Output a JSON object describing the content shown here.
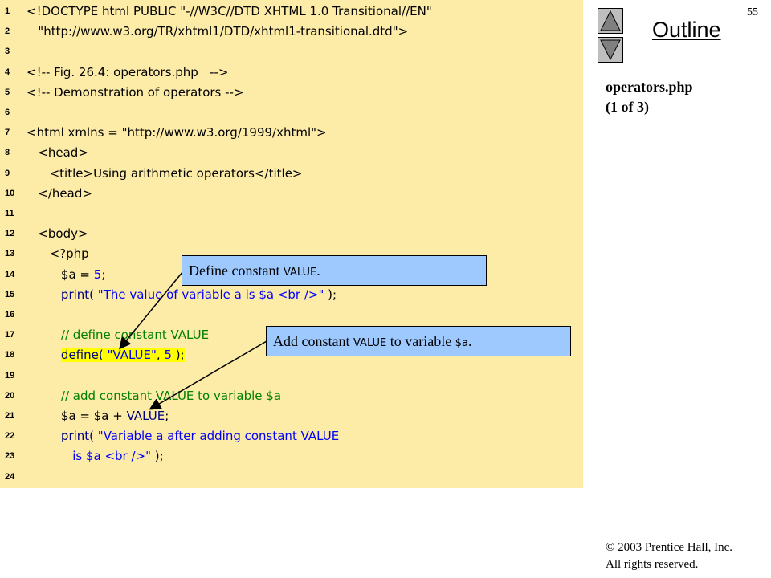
{
  "slide_number": "55",
  "outline_label": "Outline",
  "file_label_line1": "operators.php",
  "file_label_line2": "(1 of 3)",
  "copyright_line1": "© 2003 Prentice Hall, Inc.",
  "copyright_line2": "All rights reserved.",
  "callout1": {
    "prefix": "Define constant ",
    "code": "VALUE",
    "suffix": "."
  },
  "callout2": {
    "prefix": "Add constant ",
    "code": "VALUE",
    "mid": " to variable ",
    "code2": "$a",
    "suffix": "."
  },
  "code_lines": [
    {
      "n": "1",
      "segments": [
        {
          "t": "<!DOCTYPE html PUBLIC \"-//W3C//DTD XHTML 1.0 Transitional//EN\"",
          "c": "plain"
        }
      ]
    },
    {
      "n": "2",
      "segments": [
        {
          "t": "   \"http://www.w3.org/TR/xhtml1/DTD/xhtml1-transitional.dtd\">",
          "c": "plain"
        }
      ]
    },
    {
      "n": "3",
      "segments": []
    },
    {
      "n": "4",
      "segments": [
        {
          "t": "<!-- Fig. 26.4: operators.php   -->",
          "c": "plain"
        }
      ]
    },
    {
      "n": "5",
      "segments": [
        {
          "t": "<!-- Demonstration of operators -->",
          "c": "plain"
        }
      ]
    },
    {
      "n": "6",
      "segments": []
    },
    {
      "n": "7",
      "segments": [
        {
          "t": "<html xmlns = \"http://www.w3.org/1999/xhtml\">",
          "c": "plain"
        }
      ]
    },
    {
      "n": "8",
      "segments": [
        {
          "t": "   <head>",
          "c": "plain"
        }
      ]
    },
    {
      "n": "9",
      "segments": [
        {
          "t": "      <title>Using arithmetic operators</title>",
          "c": "plain"
        }
      ]
    },
    {
      "n": "10",
      "segments": [
        {
          "t": "   </head>",
          "c": "plain"
        }
      ]
    },
    {
      "n": "11",
      "segments": []
    },
    {
      "n": "12",
      "segments": [
        {
          "t": "   <body>",
          "c": "plain"
        }
      ]
    },
    {
      "n": "13",
      "segments": [
        {
          "t": "      <?php",
          "c": "plain"
        }
      ]
    },
    {
      "n": "14",
      "segments": [
        {
          "t": "         $a = ",
          "c": "plain"
        },
        {
          "t": "5",
          "c": "str"
        },
        {
          "t": ";",
          "c": "plain"
        }
      ]
    },
    {
      "n": "15",
      "segments": [
        {
          "t": "         ",
          "c": "plain"
        },
        {
          "t": "print(",
          "c": "kw"
        },
        {
          "t": " \"The value of variable a is $a <br />\"",
          "c": "str"
        },
        {
          "t": " );",
          "c": "plain"
        }
      ]
    },
    {
      "n": "16",
      "segments": []
    },
    {
      "n": "17",
      "segments": [
        {
          "t": "         ",
          "c": "plain"
        },
        {
          "t": "// define constant VALUE",
          "c": "cmt"
        }
      ]
    },
    {
      "n": "18",
      "segments": [
        {
          "t": "         ",
          "c": "plain"
        },
        {
          "t": "define(",
          "c": "kwhl"
        },
        {
          "t": " \"VALUE\"",
          "c": "strhl"
        },
        {
          "t": ", ",
          "c": "plainhl"
        },
        {
          "t": "5",
          "c": "strhl"
        },
        {
          "t": " );",
          "c": "plainhl"
        }
      ]
    },
    {
      "n": "19",
      "segments": []
    },
    {
      "n": "20",
      "segments": [
        {
          "t": "         ",
          "c": "plain"
        },
        {
          "t": "// add constant VALUE to variable $a",
          "c": "cmt"
        }
      ]
    },
    {
      "n": "21",
      "segments": [
        {
          "t": "         $a = $a + ",
          "c": "plain"
        },
        {
          "t": "VALUE",
          "c": "kw"
        },
        {
          "t": ";",
          "c": "plain"
        }
      ]
    },
    {
      "n": "22",
      "segments": [
        {
          "t": "         ",
          "c": "plain"
        },
        {
          "t": "print(",
          "c": "kw"
        },
        {
          "t": " \"Variable a after adding constant VALUE",
          "c": "str"
        }
      ]
    },
    {
      "n": "23",
      "segments": [
        {
          "t": "            is $a <br />\"",
          "c": "str"
        },
        {
          "t": " );",
          "c": "plain"
        }
      ]
    },
    {
      "n": "24",
      "segments": []
    }
  ]
}
